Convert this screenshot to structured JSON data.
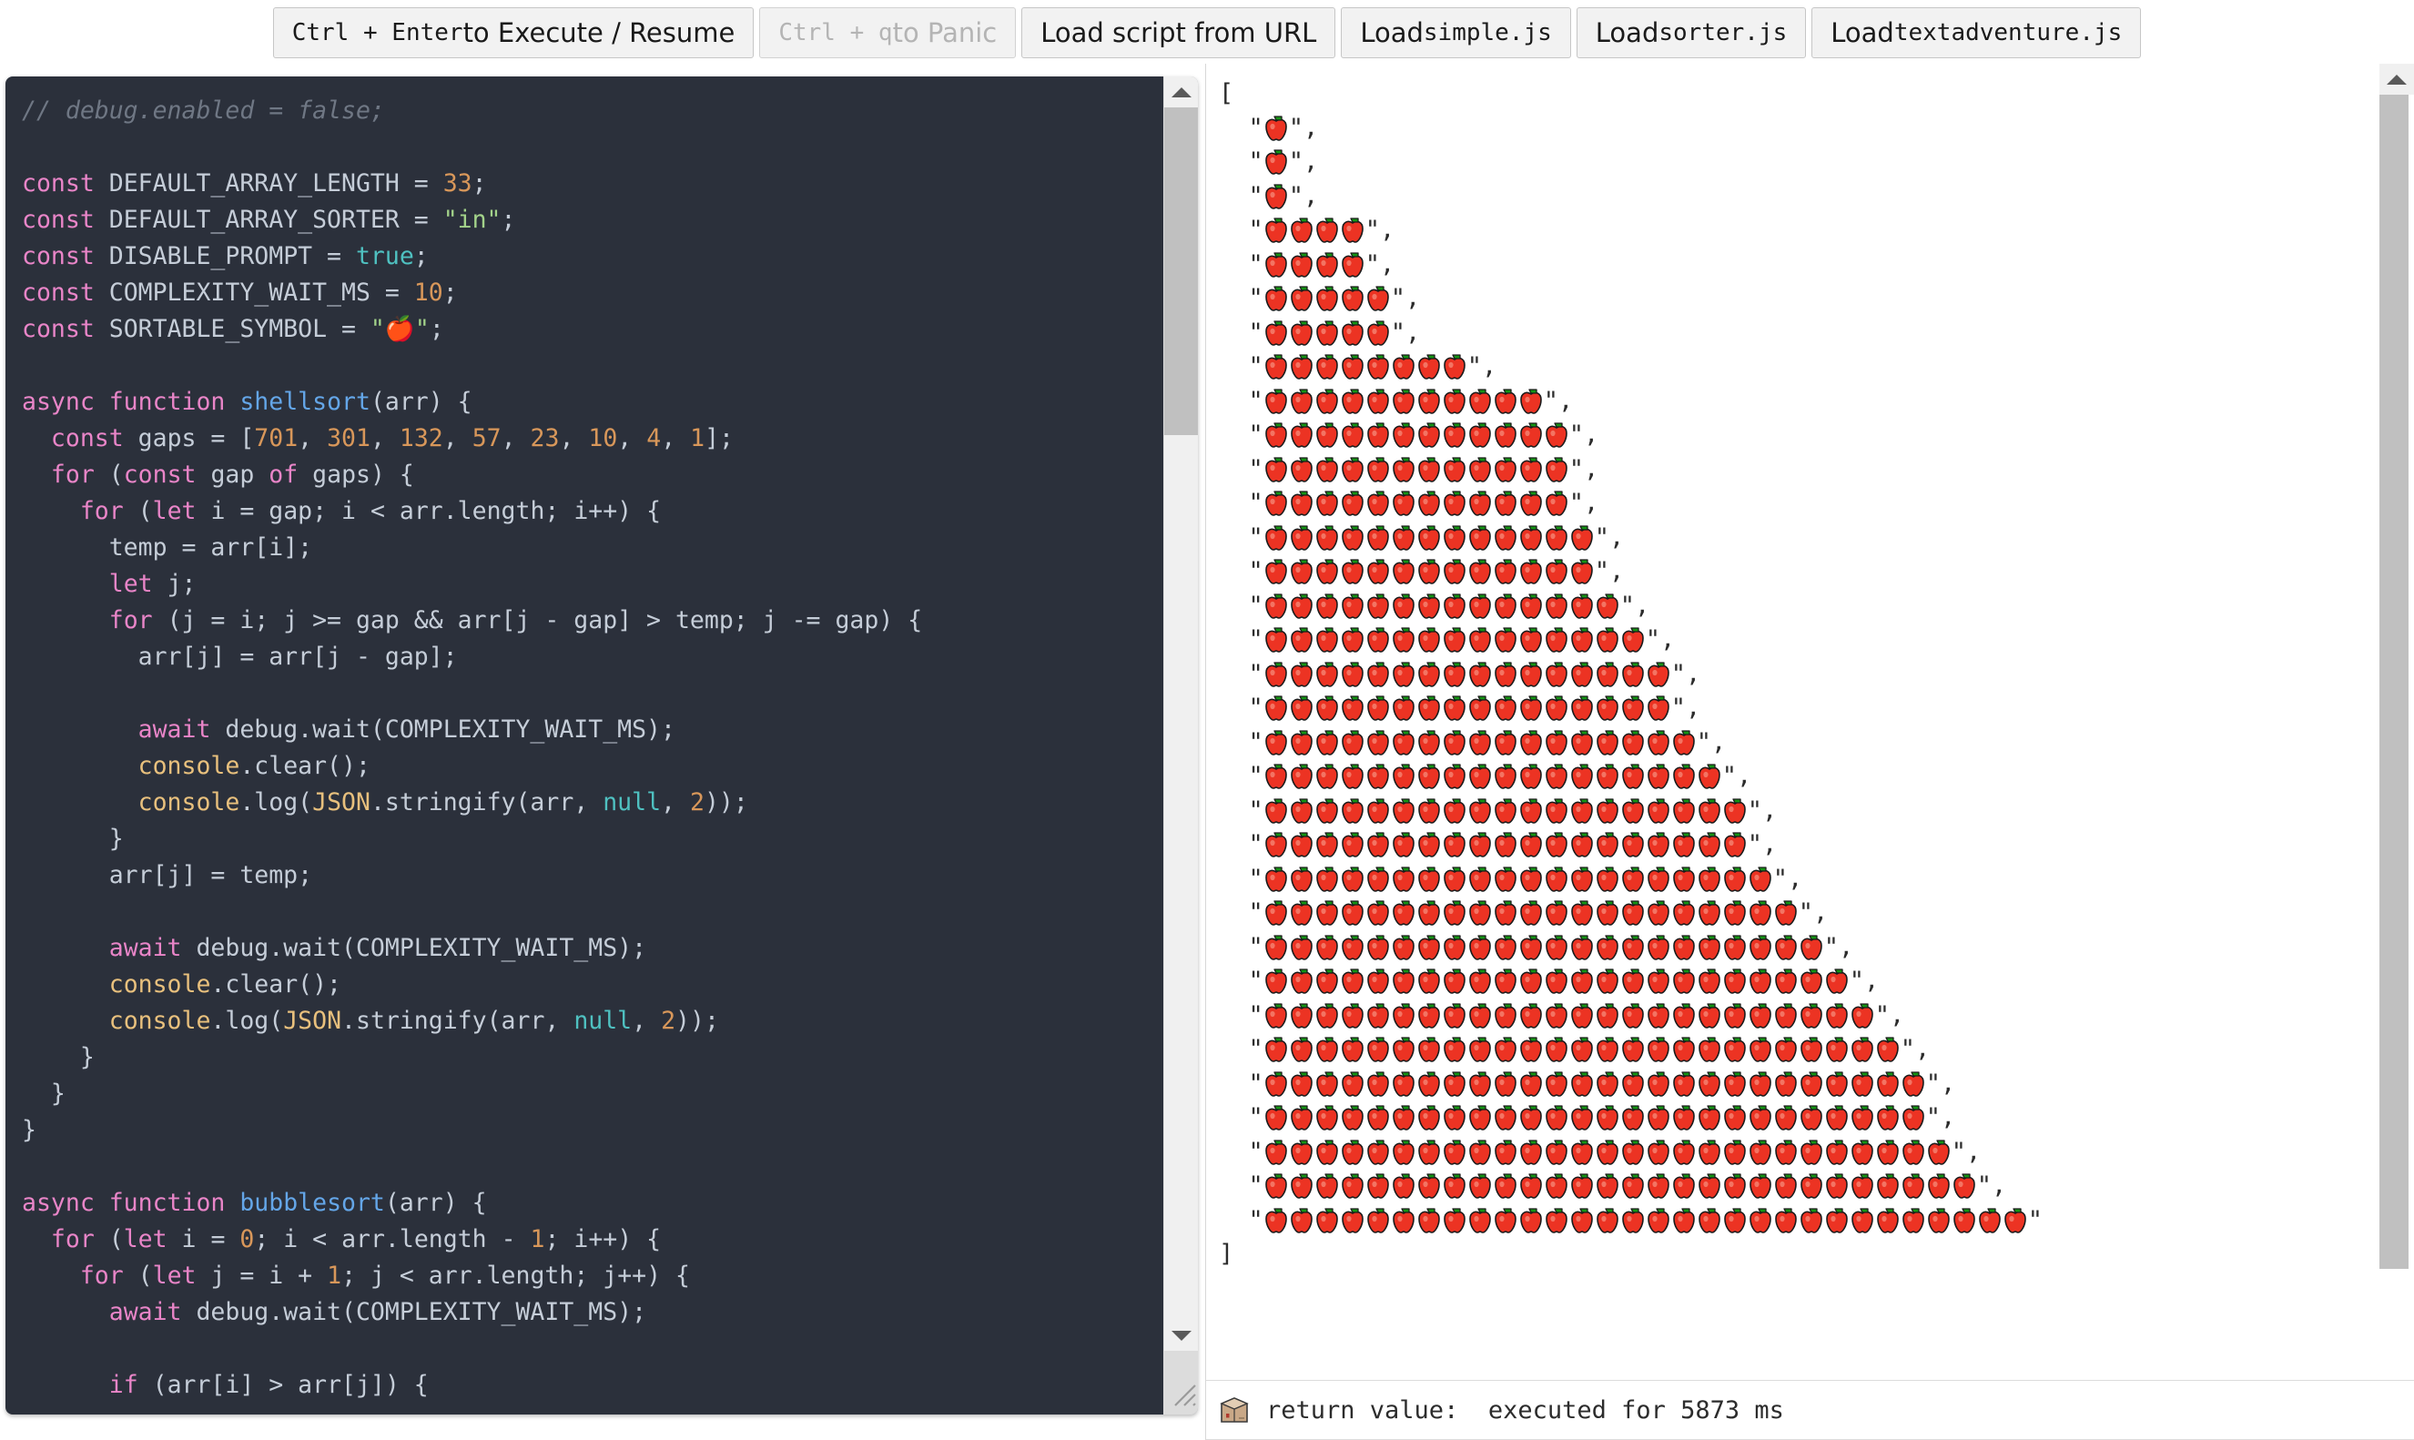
{
  "toolbar": {
    "buttons": [
      {
        "name": "execute-resume",
        "prefix": "Ctrl + Enter",
        "suffix": " to Execute / Resume",
        "disabled": false,
        "mono_prefix": true
      },
      {
        "name": "panic",
        "prefix": "Ctrl + q",
        "suffix": " to Panic",
        "disabled": true,
        "mono_prefix": true
      },
      {
        "name": "load-from-url",
        "prefix": "",
        "suffix": "Load script from URL",
        "disabled": false,
        "mono_prefix": false
      },
      {
        "name": "load-simple-js",
        "prefix": "Load ",
        "suffix": "simple.js",
        "disabled": false,
        "mono_prefix": false,
        "mono_suffix": true
      },
      {
        "name": "load-sorter-js",
        "prefix": "Load ",
        "suffix": "sorter.js",
        "disabled": false,
        "mono_prefix": false,
        "mono_suffix": true
      },
      {
        "name": "load-textadventure-js",
        "prefix": "Load ",
        "suffix": "textadventure.js",
        "disabled": false,
        "mono_prefix": false,
        "mono_suffix": true
      }
    ]
  },
  "editor": {
    "language": "javascript",
    "theme_background": "#2b303b",
    "code_lines": [
      [
        [
          "cmt",
          "// debug.enabled = false;"
        ]
      ],
      [],
      [
        [
          "k",
          "const"
        ],
        [
          "pln",
          " DEFAULT_ARRAY_LENGTH = "
        ],
        [
          "num",
          "33"
        ],
        [
          "pln",
          ";"
        ]
      ],
      [
        [
          "k",
          "const"
        ],
        [
          "pln",
          " DEFAULT_ARRAY_SORTER = "
        ],
        [
          "str",
          "\"in\""
        ],
        [
          "pln",
          ";"
        ]
      ],
      [
        [
          "k",
          "const"
        ],
        [
          "pln",
          " DISABLE_PROMPT = "
        ],
        [
          "bool",
          "true"
        ],
        [
          "pln",
          ";"
        ]
      ],
      [
        [
          "k",
          "const"
        ],
        [
          "pln",
          " COMPLEXITY_WAIT_MS = "
        ],
        [
          "num",
          "10"
        ],
        [
          "pln",
          ";"
        ]
      ],
      [
        [
          "k",
          "const"
        ],
        [
          "pln",
          " SORTABLE_SYMBOL = "
        ],
        [
          "str",
          "\"🍎\""
        ],
        [
          "pln",
          ";"
        ]
      ],
      [],
      [
        [
          "k",
          "async function"
        ],
        [
          "pln",
          " "
        ],
        [
          "fn",
          "shellsort"
        ],
        [
          "pln",
          "(arr) {"
        ]
      ],
      [
        [
          "pln",
          "  "
        ],
        [
          "k",
          "const"
        ],
        [
          "pln",
          " gaps = ["
        ],
        [
          "num",
          "701"
        ],
        [
          "pln",
          ", "
        ],
        [
          "num",
          "301"
        ],
        [
          "pln",
          ", "
        ],
        [
          "num",
          "132"
        ],
        [
          "pln",
          ", "
        ],
        [
          "num",
          "57"
        ],
        [
          "pln",
          ", "
        ],
        [
          "num",
          "23"
        ],
        [
          "pln",
          ", "
        ],
        [
          "num",
          "10"
        ],
        [
          "pln",
          ", "
        ],
        [
          "num",
          "4"
        ],
        [
          "pln",
          ", "
        ],
        [
          "num",
          "1"
        ],
        [
          "pln",
          "];"
        ]
      ],
      [
        [
          "pln",
          "  "
        ],
        [
          "k",
          "for"
        ],
        [
          "pln",
          " ("
        ],
        [
          "k",
          "const"
        ],
        [
          "pln",
          " gap "
        ],
        [
          "k",
          "of"
        ],
        [
          "pln",
          " gaps) {"
        ]
      ],
      [
        [
          "pln",
          "    "
        ],
        [
          "k",
          "for"
        ],
        [
          "pln",
          " ("
        ],
        [
          "k",
          "let"
        ],
        [
          "pln",
          " i = gap; i < arr.length; i++) {"
        ]
      ],
      [
        [
          "pln",
          "      temp = arr[i];"
        ]
      ],
      [
        [
          "pln",
          "      "
        ],
        [
          "k",
          "let"
        ],
        [
          "pln",
          " j;"
        ]
      ],
      [
        [
          "pln",
          "      "
        ],
        [
          "k",
          "for"
        ],
        [
          "pln",
          " (j = i; j >= gap && arr[j - gap] > temp; j -= gap) {"
        ]
      ],
      [
        [
          "pln",
          "        arr[j] = arr[j - gap];"
        ]
      ],
      [],
      [
        [
          "pln",
          "        "
        ],
        [
          "k",
          "await"
        ],
        [
          "pln",
          " debug.wait(COMPLEXITY_WAIT_MS);"
        ]
      ],
      [
        [
          "pln",
          "        "
        ],
        [
          "obj",
          "console"
        ],
        [
          "pln",
          ".clear();"
        ]
      ],
      [
        [
          "pln",
          "        "
        ],
        [
          "obj",
          "console"
        ],
        [
          "pln",
          ".log("
        ],
        [
          "obj",
          "JSON"
        ],
        [
          "pln",
          ".stringify(arr, "
        ],
        [
          "bool",
          "null"
        ],
        [
          "pln",
          ", "
        ],
        [
          "num",
          "2"
        ],
        [
          "pln",
          "));"
        ]
      ],
      [
        [
          "pln",
          "      }"
        ]
      ],
      [
        [
          "pln",
          "      arr[j] = temp;"
        ]
      ],
      [],
      [
        [
          "pln",
          "      "
        ],
        [
          "k",
          "await"
        ],
        [
          "pln",
          " debug.wait(COMPLEXITY_WAIT_MS);"
        ]
      ],
      [
        [
          "pln",
          "      "
        ],
        [
          "obj",
          "console"
        ],
        [
          "pln",
          ".clear();"
        ]
      ],
      [
        [
          "pln",
          "      "
        ],
        [
          "obj",
          "console"
        ],
        [
          "pln",
          ".log("
        ],
        [
          "obj",
          "JSON"
        ],
        [
          "pln",
          ".stringify(arr, "
        ],
        [
          "bool",
          "null"
        ],
        [
          "pln",
          ", "
        ],
        [
          "num",
          "2"
        ],
        [
          "pln",
          "));"
        ]
      ],
      [
        [
          "pln",
          "    }"
        ]
      ],
      [
        [
          "pln",
          "  }"
        ]
      ],
      [
        [
          "pln",
          "}"
        ]
      ],
      [],
      [
        [
          "k",
          "async function"
        ],
        [
          "pln",
          " "
        ],
        [
          "fn",
          "bubblesort"
        ],
        [
          "pln",
          "(arr) {"
        ]
      ],
      [
        [
          "pln",
          "  "
        ],
        [
          "k",
          "for"
        ],
        [
          "pln",
          " ("
        ],
        [
          "k",
          "let"
        ],
        [
          "pln",
          " i = "
        ],
        [
          "num",
          "0"
        ],
        [
          "pln",
          "; i < arr.length - "
        ],
        [
          "num",
          "1"
        ],
        [
          "pln",
          "; i++) {"
        ]
      ],
      [
        [
          "pln",
          "    "
        ],
        [
          "k",
          "for"
        ],
        [
          "pln",
          " ("
        ],
        [
          "k",
          "let"
        ],
        [
          "pln",
          " j = i + "
        ],
        [
          "num",
          "1"
        ],
        [
          "pln",
          "; j < arr.length; j++) {"
        ]
      ],
      [
        [
          "pln",
          "      "
        ],
        [
          "k",
          "await"
        ],
        [
          "pln",
          " debug.wait(COMPLEXITY_WAIT_MS);"
        ]
      ],
      [],
      [
        [
          "pln",
          "      "
        ],
        [
          "k",
          "if"
        ],
        [
          "pln",
          " (arr[i] > arr[j]) {"
        ]
      ]
    ]
  },
  "output": {
    "symbol": "🍎",
    "open_bracket": "[",
    "close_bracket": "]",
    "quote": "\"",
    "comma": ",",
    "apple_counts": [
      1,
      1,
      1,
      4,
      4,
      5,
      5,
      8,
      11,
      12,
      12,
      12,
      13,
      13,
      14,
      15,
      16,
      16,
      17,
      18,
      19,
      19,
      20,
      21,
      22,
      23,
      24,
      25,
      26,
      26,
      27,
      28,
      30
    ]
  },
  "statusbar": {
    "icon": "package-icon",
    "text": "return value:  executed for 5873 ms"
  }
}
